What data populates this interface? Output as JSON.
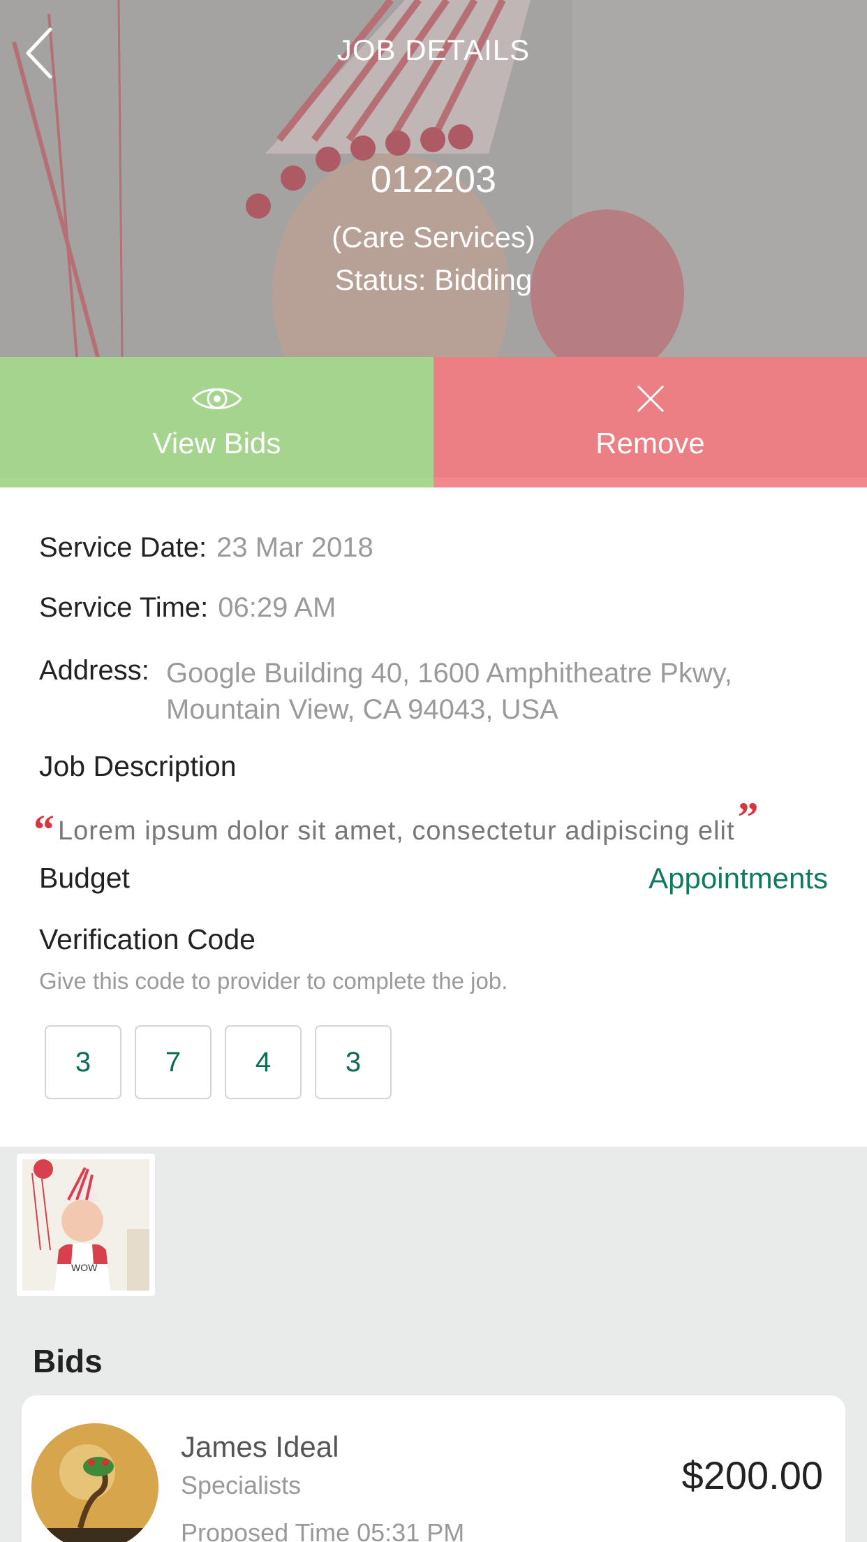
{
  "header": {
    "title": "JOB DETAILS",
    "job_id": "012203",
    "category": "(Care Services)",
    "status": "Status:  Bidding"
  },
  "actions": {
    "view_bids": "View Bids",
    "remove": "Remove"
  },
  "details": {
    "service_date_label": "Service Date:",
    "service_date_value": "23 Mar 2018",
    "service_time_label": "Service Time:",
    "service_time_value": "06:29 AM",
    "address_label": "Address:",
    "address_value": "Google Building 40, 1600 Amphitheatre Pkwy, Mountain View, CA 94043, USA",
    "job_description_label": "Job Description",
    "job_description": "Lorem ipsum dolor sit amet, consectetur adipiscing elit",
    "budget_label": "Budget",
    "appointments_link": "Appointments"
  },
  "verification": {
    "title": "Verification Code",
    "hint": "Give this code to provider to complete the job.",
    "digits": [
      "3",
      "7",
      "4",
      "3"
    ]
  },
  "bids": {
    "title": "Bids",
    "items": [
      {
        "name": "James Ideal",
        "role": "Specialists",
        "proposed_time": "Proposed Time  05:31 PM",
        "amount": "$200.00"
      }
    ]
  },
  "colors": {
    "view_bids": "#8cc86e",
    "remove": "#e65f64",
    "accent": "#0e7a61",
    "quote_mark": "#d9343f"
  }
}
